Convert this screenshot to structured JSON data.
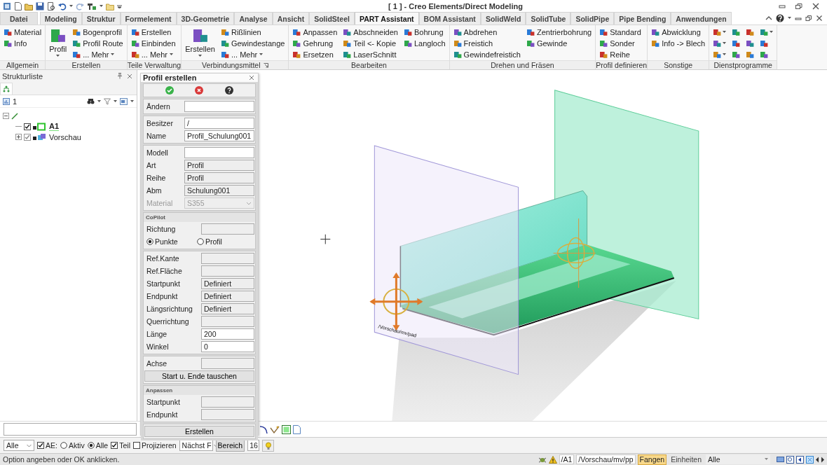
{
  "window": {
    "title": "[ 1 ] - Creo Elements/Direct Modeling"
  },
  "tabs": [
    {
      "label": "Datei",
      "selected": false,
      "kind": "file"
    },
    {
      "label": "Modeling",
      "selected": false
    },
    {
      "label": "Struktur",
      "selected": false
    },
    {
      "label": "Formelement",
      "selected": false
    },
    {
      "label": "3D-Geometrie",
      "selected": false
    },
    {
      "label": "Analyse",
      "selected": false
    },
    {
      "label": "Ansicht",
      "selected": false
    },
    {
      "label": "SolidSteel",
      "selected": false
    },
    {
      "label": "PART Assistant",
      "selected": true
    },
    {
      "label": "BOM Assistant",
      "selected": false
    },
    {
      "label": "SolidWeld",
      "selected": false
    },
    {
      "label": "SolidTube",
      "selected": false
    },
    {
      "label": "SolidPipe",
      "selected": false
    },
    {
      "label": "Pipe Bending",
      "selected": false
    },
    {
      "label": "Anwendungen",
      "selected": false
    }
  ],
  "ribbon": {
    "groups": [
      {
        "label": "Allgemein",
        "items": [
          {
            "label": "Material",
            "kind": "small"
          },
          {
            "label": "Info",
            "kind": "small"
          }
        ]
      },
      {
        "label": "Erstellen",
        "items": [
          {
            "label": "Profil",
            "kind": "large",
            "dropdown": true
          },
          {
            "label": "Bogenprofil",
            "kind": "small"
          },
          {
            "label": "Profil Route",
            "kind": "small"
          },
          {
            "label": "... Mehr",
            "kind": "small",
            "dropdown": true
          }
        ]
      },
      {
        "label": "Teile Verwaltung",
        "items": [
          {
            "label": "Erstellen",
            "kind": "small"
          },
          {
            "label": "Einbinden",
            "kind": "small"
          },
          {
            "label": "... Mehr",
            "kind": "small",
            "dropdown": true
          }
        ]
      },
      {
        "label": "Verbindungsmittel",
        "launcher": true,
        "items": [
          {
            "label": "Erstellen",
            "kind": "large",
            "dropdown": true
          },
          {
            "label": "Rißlinien",
            "kind": "small"
          },
          {
            "label": "Gewindestange",
            "kind": "small"
          },
          {
            "label": "... Mehr",
            "kind": "small",
            "dropdown": true
          }
        ]
      },
      {
        "label": "Bearbeiten",
        "items": [
          {
            "label": "Anpassen",
            "kind": "small"
          },
          {
            "label": "Gehrung",
            "kind": "small"
          },
          {
            "label": "Ersetzen",
            "kind": "small"
          },
          {
            "label": "Abschneiden",
            "kind": "small"
          },
          {
            "label": "Teil <- Kopie",
            "kind": "small"
          },
          {
            "label": "LaserSchnitt",
            "kind": "small"
          },
          {
            "label": "Bohrung",
            "kind": "small"
          },
          {
            "label": "Langloch",
            "kind": "small"
          }
        ]
      },
      {
        "label": "Drehen und Fräsen",
        "items": [
          {
            "label": "Abdrehen",
            "kind": "small"
          },
          {
            "label": "Freistich",
            "kind": "small"
          },
          {
            "label": "Gewindefreistich",
            "kind": "small"
          },
          {
            "label": "Zentrierbohrung",
            "kind": "small"
          },
          {
            "label": "Gewinde",
            "kind": "small"
          }
        ]
      },
      {
        "label": "Profil definieren",
        "items": [
          {
            "label": "Standard",
            "kind": "small"
          },
          {
            "label": "Sonder",
            "kind": "small"
          },
          {
            "label": "Reihe",
            "kind": "small"
          }
        ]
      },
      {
        "label": "Sonstige",
        "items": [
          {
            "label": "Abwicklung",
            "kind": "small"
          },
          {
            "label": "Info -> Blech",
            "kind": "small"
          }
        ]
      },
      {
        "label": "Dienstprogramme",
        "items": [
          {
            "kind": "icon",
            "dropdown": true
          },
          {
            "kind": "icon",
            "dropdown": true
          },
          {
            "kind": "icon",
            "dropdown": true
          },
          {
            "kind": "icon"
          },
          {
            "kind": "icon"
          },
          {
            "kind": "icon"
          },
          {
            "kind": "icon"
          },
          {
            "kind": "icon"
          },
          {
            "kind": "icon"
          },
          {
            "kind": "icon",
            "dropdown": true
          },
          {
            "kind": "icon"
          },
          {
            "kind": "icon"
          }
        ]
      }
    ]
  },
  "structure_panel": {
    "title": "Strukturliste",
    "counter": "1",
    "tree": [
      {
        "expanded": true,
        "children": [
          {
            "label": "A1",
            "checked": true,
            "active": true
          },
          {
            "label": "Vorschau",
            "checked": true,
            "active": false,
            "expanded": false
          }
        ]
      }
    ]
  },
  "dialog": {
    "title": "Profil erstellen",
    "sections": [
      {
        "rows": [
          {
            "kind": "field",
            "label": "Ändern",
            "value": "",
            "editable": true
          }
        ]
      },
      {
        "rows": [
          {
            "kind": "field",
            "label": "Besitzer",
            "value": "/",
            "editable": true
          },
          {
            "kind": "field",
            "label": "Name",
            "value": "Profil_Schulung001",
            "editable": true
          }
        ]
      },
      {
        "rows": [
          {
            "kind": "field",
            "label": "Modell",
            "value": "",
            "editable": true
          },
          {
            "kind": "field",
            "label": "Art",
            "value": "Profil",
            "editable": false
          },
          {
            "kind": "field",
            "label": "Reihe",
            "value": "Profil",
            "editable": false
          },
          {
            "kind": "field",
            "label": "Abm",
            "value": "Schulung001",
            "editable": false
          },
          {
            "kind": "select",
            "label": "Material",
            "value": "S355",
            "disabled": true
          }
        ]
      },
      {
        "heading": "CoPilot",
        "rows": [
          {
            "kind": "short",
            "label": "Richtung",
            "value": "",
            "editable": false
          },
          {
            "kind": "radio",
            "options": [
              {
                "label": "Punkte",
                "selected": true
              },
              {
                "label": "Profil",
                "selected": false
              }
            ]
          }
        ]
      },
      {
        "rows": [
          {
            "kind": "short",
            "label": "Ref.Kante",
            "value": "",
            "editable": false
          },
          {
            "kind": "short",
            "label": "Ref.Fläche",
            "value": "",
            "editable": false
          },
          {
            "kind": "short",
            "label": "Startpunkt",
            "value": "Definiert",
            "editable": false
          },
          {
            "kind": "short",
            "label": "Endpunkt",
            "value": "Definiert",
            "editable": false
          },
          {
            "kind": "short",
            "label": "Längsrichtung",
            "value": "Definiert",
            "editable": false
          },
          {
            "kind": "short",
            "label": "Querrichtung",
            "value": "",
            "editable": false
          },
          {
            "kind": "short",
            "label": "Länge",
            "value": "200",
            "editable": true
          },
          {
            "kind": "short",
            "label": "Winkel",
            "value": "0",
            "editable": true
          }
        ]
      },
      {
        "rows": [
          {
            "kind": "short",
            "label": "Achse",
            "value": "",
            "editable": false
          },
          {
            "kind": "button",
            "label": "Start u. Ende tauschen"
          }
        ]
      },
      {
        "heading": "Anpassen",
        "rows": [
          {
            "kind": "short",
            "label": "Startpunkt",
            "value": "",
            "editable": false
          },
          {
            "kind": "short",
            "label": "Endpunkt",
            "value": "",
            "editable": false
          }
        ]
      },
      {
        "rows": [
          {
            "kind": "button",
            "label": "Erstellen"
          }
        ]
      }
    ]
  },
  "viewport": {
    "model_label": "/Vorschau/mv/pad"
  },
  "filter_bar": [
    {
      "kind": "select",
      "value": "Alle"
    },
    {
      "kind": "checkbox",
      "label": "AE:",
      "checked": true
    },
    {
      "kind": "radio",
      "label": "Aktiv",
      "selected": false
    },
    {
      "kind": "radio",
      "label": "Alle",
      "selected": true
    },
    {
      "kind": "checkbox",
      "label": "Teil",
      "checked": true
    },
    {
      "kind": "checkbox",
      "label": "Projizieren",
      "checked": false
    },
    {
      "kind": "select",
      "value": "Nächst F"
    },
    {
      "kind": "button",
      "label": "Bereich"
    },
    {
      "kind": "field",
      "value": "16"
    }
  ],
  "status_bar": {
    "message": "Option angeben oder OK anklicken.",
    "paths": [
      "/A1",
      "/Vorschau/mv/pp"
    ],
    "toggles": [
      {
        "label": "Fangen",
        "selected": true
      },
      {
        "label": "Einheiten",
        "selected": false
      }
    ],
    "filter": "Alle"
  }
}
